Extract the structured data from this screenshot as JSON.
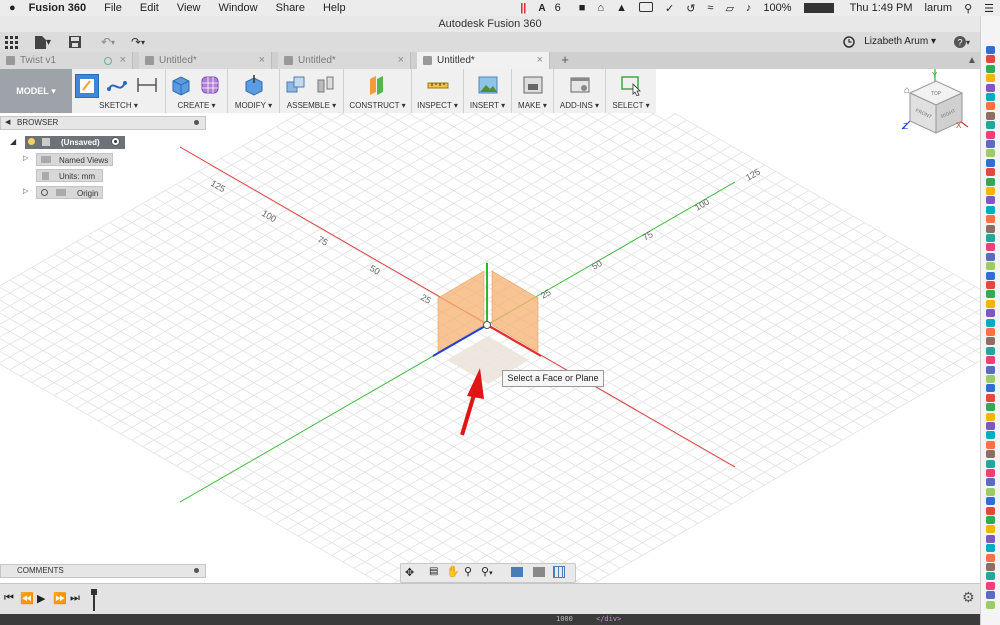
{
  "menubar": {
    "app_name": "Fusion 360",
    "items": [
      "File",
      "Edit",
      "View",
      "Window",
      "Share",
      "Help"
    ],
    "status": {
      "adobe_count": "6",
      "battery": "100%",
      "clock": "Thu 1:49 PM",
      "user": "larum"
    }
  },
  "window": {
    "title": "Autodesk Fusion 360"
  },
  "quick_access": {
    "user_name": "Lizabeth Arum"
  },
  "tabs": [
    {
      "label": "Twist v1",
      "active": false
    },
    {
      "label": "Untitled*",
      "active": false
    },
    {
      "label": "Untitled*",
      "active": false
    },
    {
      "label": "Untitled*",
      "active": true
    }
  ],
  "ribbon": {
    "mode": "MODEL",
    "groups": [
      "SKETCH",
      "CREATE",
      "MODIFY",
      "ASSEMBLE",
      "CONSTRUCT",
      "INSPECT",
      "INSERT",
      "MAKE",
      "ADD-INS",
      "SELECT"
    ]
  },
  "browser": {
    "title": "BROWSER",
    "root": "(Unsaved)",
    "nodes": [
      "Named Views",
      "Units: mm",
      "Origin"
    ]
  },
  "comments": {
    "title": "COMMENTS"
  },
  "viewcube": {
    "axis_x": "X",
    "axis_y": "Y",
    "axis_z": "Z",
    "top": "TOP",
    "front": "FRONT",
    "right": "RIGHT"
  },
  "grid_labels": {
    "red_axis": [
      "125",
      "100",
      "75",
      "50",
      "25"
    ],
    "green_axis": [
      "125",
      "100",
      "75",
      "50",
      "25"
    ]
  },
  "tooltip": {
    "text": "Select a Face or Plane"
  },
  "colors": {
    "x_axis": "#e03030",
    "y_axis": "#2fb52f",
    "z_axis": "#1d3fd8",
    "plane": "#f6b070",
    "arrow": "#e01515",
    "ribbon_mode": "#9da3a8"
  },
  "taskbar": {
    "left_text": "1000",
    "right_text": "</div>"
  }
}
